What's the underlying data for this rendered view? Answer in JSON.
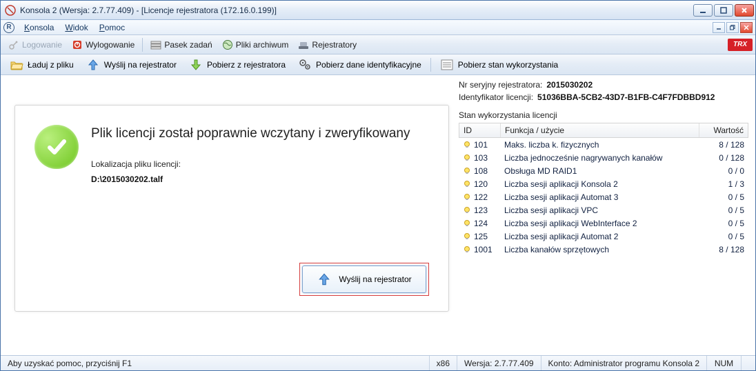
{
  "window": {
    "title": "Konsola 2 (Wersja:  2.7.77.409) - [Licencje rejestratora (172.16.0.199)]"
  },
  "menu": {
    "konsola": "Konsola",
    "widok": "Widok",
    "pomoc": "Pomoc"
  },
  "toolbar1": {
    "logowanie": "Logowanie",
    "wylogowanie": "Wylogowanie",
    "pasek_zadan": "Pasek zadań",
    "pliki_archiwum": "Pliki archiwum",
    "rejestratory": "Rejestratory"
  },
  "toolbar2": {
    "laduj": "Ładuj z pliku",
    "wyslij": "Wyślij na rejestrator",
    "pobierz": "Pobierz z rejestratora",
    "pobierz_dane": "Pobierz dane identyfikacyjne",
    "pobierz_stan": "Pobierz stan wykorzystania"
  },
  "license": {
    "title": "Plik licencji został poprawnie wczytany i zweryfikowany",
    "loc_label": "Lokalizacja pliku licencji:",
    "path": "D:\\2015030202.talf",
    "send_label": "Wyślij na rejestrator"
  },
  "info": {
    "serial_label": "Nr seryjny rejestratora:",
    "serial_value": "2015030202",
    "lic_id_label": "Identyfikator licencji:",
    "lic_id_value": "51036BBA-5CB2-43D7-B1FB-C4F7FDBBD912",
    "usage_title": "Stan wykorzystania licencji"
  },
  "table": {
    "headers": {
      "id": "ID",
      "fn": "Funkcja / użycie",
      "val": "Wartość"
    },
    "rows": [
      {
        "id": "101",
        "fn": "Maks. liczba k. fizycznych",
        "val": "8 / 128"
      },
      {
        "id": "103",
        "fn": "Liczba jednocześnie nagrywanych kanałów",
        "val": "0 / 128"
      },
      {
        "id": "108",
        "fn": "Obsługa MD RAID1",
        "val": "0 / 0"
      },
      {
        "id": "120",
        "fn": "Liczba sesji aplikacji Konsola 2",
        "val": "1 / 3"
      },
      {
        "id": "122",
        "fn": "Liczba sesji aplikacji Automat 3",
        "val": "0 / 5"
      },
      {
        "id": "123",
        "fn": "Liczba sesji aplikacji VPC",
        "val": "0 / 5"
      },
      {
        "id": "124",
        "fn": "Liczba sesji aplikacji WebInterface 2",
        "val": "0 / 5"
      },
      {
        "id": "125",
        "fn": "Liczba sesji aplikacji Automat 2",
        "val": "0 / 5"
      },
      {
        "id": "1001",
        "fn": "Liczba kanałów sprzętowych",
        "val": "8 / 128"
      }
    ]
  },
  "statusbar": {
    "help": "Aby uzyskać pomoc, przyciśnij F1",
    "arch": "x86",
    "version": "Wersja: 2.7.77.409",
    "account": "Konto: Administrator programu Konsola 2",
    "num": "NUM"
  }
}
